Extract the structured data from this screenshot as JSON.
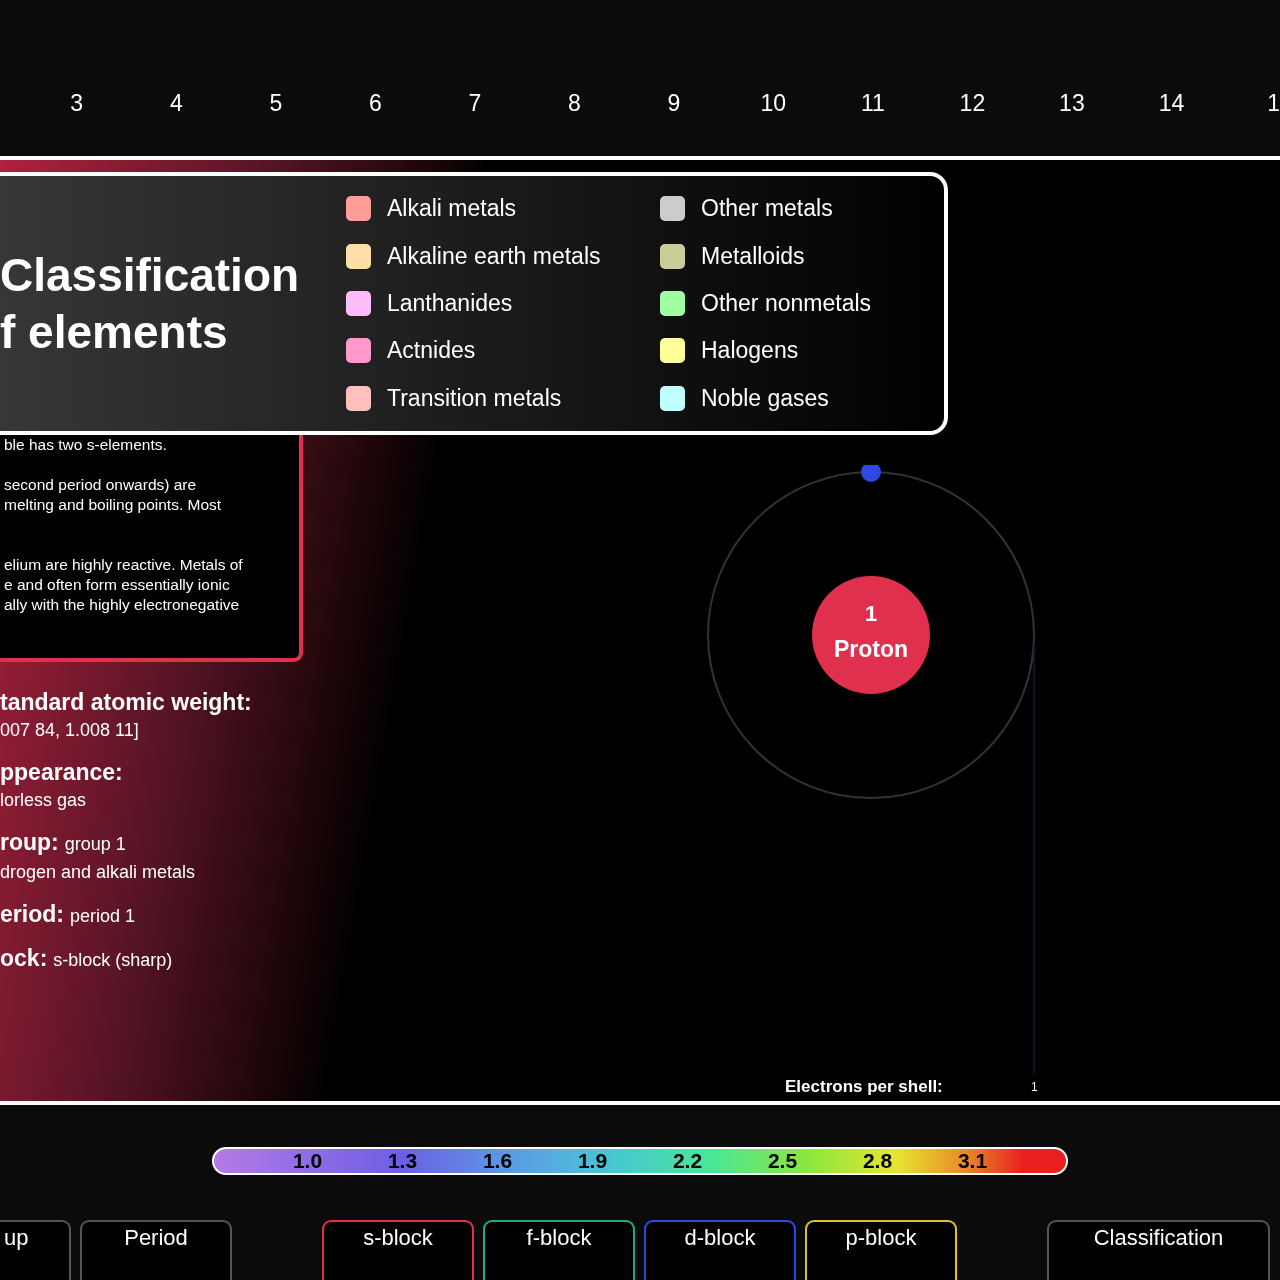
{
  "group_numbers": [
    "3",
    "4",
    "5",
    "6",
    "7",
    "8",
    "9",
    "10",
    "11",
    "12",
    "13",
    "14",
    "1"
  ],
  "classification": {
    "title_lines": [
      "Classification",
      "f elements"
    ],
    "items": [
      {
        "label": "Alkali metals",
        "color": "#ff9e98"
      },
      {
        "label": "Alkaline earth metals",
        "color": "#ffdea8"
      },
      {
        "label": "Lanthanides",
        "color": "#ffbcfc"
      },
      {
        "label": "Actnides",
        "color": "#ff98cb"
      },
      {
        "label": "Transition metals",
        "color": "#ffc0bd"
      },
      {
        "label": "Other metals",
        "color": "#cccccc"
      },
      {
        "label": "Metalloids",
        "color": "#cccc98"
      },
      {
        "label": "Other nonmetals",
        "color": "#a0ffa0"
      },
      {
        "label": "Halogens",
        "color": "#ffff9a"
      },
      {
        "label": "Noble gases",
        "color": "#c0ffff"
      }
    ]
  },
  "description": [
    [
      "ble has two s-elements."
    ],
    [
      "second period onwards) are",
      "melting and boiling points. Most"
    ],
    [
      "elium are highly reactive. Metals of",
      "e and often form essentially ionic",
      "ally with the highly electronegative"
    ]
  ],
  "properties": [
    {
      "label": "tandard atomic weight:",
      "lines": [
        "007 84, 1.008 11]"
      ]
    },
    {
      "label": "ppearance:",
      "lines": [
        "lorless gas"
      ]
    },
    {
      "label": "roup:",
      "value": "group 1",
      "lines": [
        "drogen and alkali metals"
      ]
    },
    {
      "label": "eriod:",
      "value": "period 1"
    },
    {
      "label": "ock:",
      "value": "s-block (sharp)"
    }
  ],
  "atom": {
    "nucleus_count": "1",
    "nucleus_label": "Proton",
    "electrons_label": "Electrons per shell:",
    "electrons_value": "1"
  },
  "scale": [
    "1.0",
    "1.3",
    "1.6",
    "1.9",
    "2.2",
    "2.5",
    "2.8",
    "3.1"
  ],
  "tab_groups": [
    [
      {
        "label": "up"
      },
      {
        "label": "Period"
      }
    ],
    [
      {
        "label": "s-block",
        "color": "#e0304e"
      },
      {
        "label": "f-block",
        "color": "#1fa88a"
      },
      {
        "label": "d-block",
        "color": "#2f48e0"
      },
      {
        "label": "p-block",
        "color": "#e0c020"
      }
    ],
    [
      {
        "label": "Classification"
      }
    ]
  ]
}
